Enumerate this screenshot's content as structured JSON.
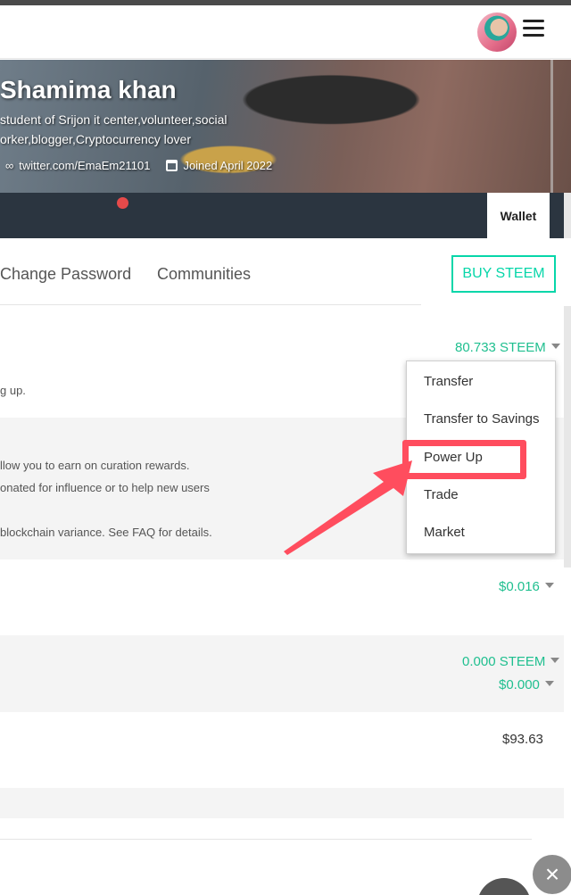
{
  "header": {
    "avatar_icon": "avatar",
    "menu_icon": "hamburger-icon"
  },
  "profile": {
    "name": "Shamima khan",
    "bio": "student of Srijon it center,volunteer,social orker,blogger,Cryptocurrency lover",
    "link": "twitter.com/EmaEm21101",
    "joined": "Joined April 2022"
  },
  "nav": {
    "wallet": "Wallet"
  },
  "tabs": {
    "change_password": "Change Password",
    "communities": "Communities"
  },
  "buy_button": "BUY STEEM",
  "balances": {
    "steem": "80.733 STEEM",
    "steem_desc": "g up.",
    "sp_desc_1": "llow you to earn on curation rewards.",
    "sp_desc_2": "onated for influence or to help new users",
    "sp_desc_3": "blockchain variance. See FAQ for details.",
    "sbd": "$0.016",
    "savings_steem": "0.000 STEEM",
    "savings_usd": "$0.000",
    "estimated": "$93.63"
  },
  "dropdown": {
    "items": [
      "Transfer",
      "Transfer to Savings",
      "Power Up",
      "Trade",
      "Market"
    ]
  },
  "annotation": {
    "highlight_color": "#ff4d5e"
  },
  "close_label": "×"
}
